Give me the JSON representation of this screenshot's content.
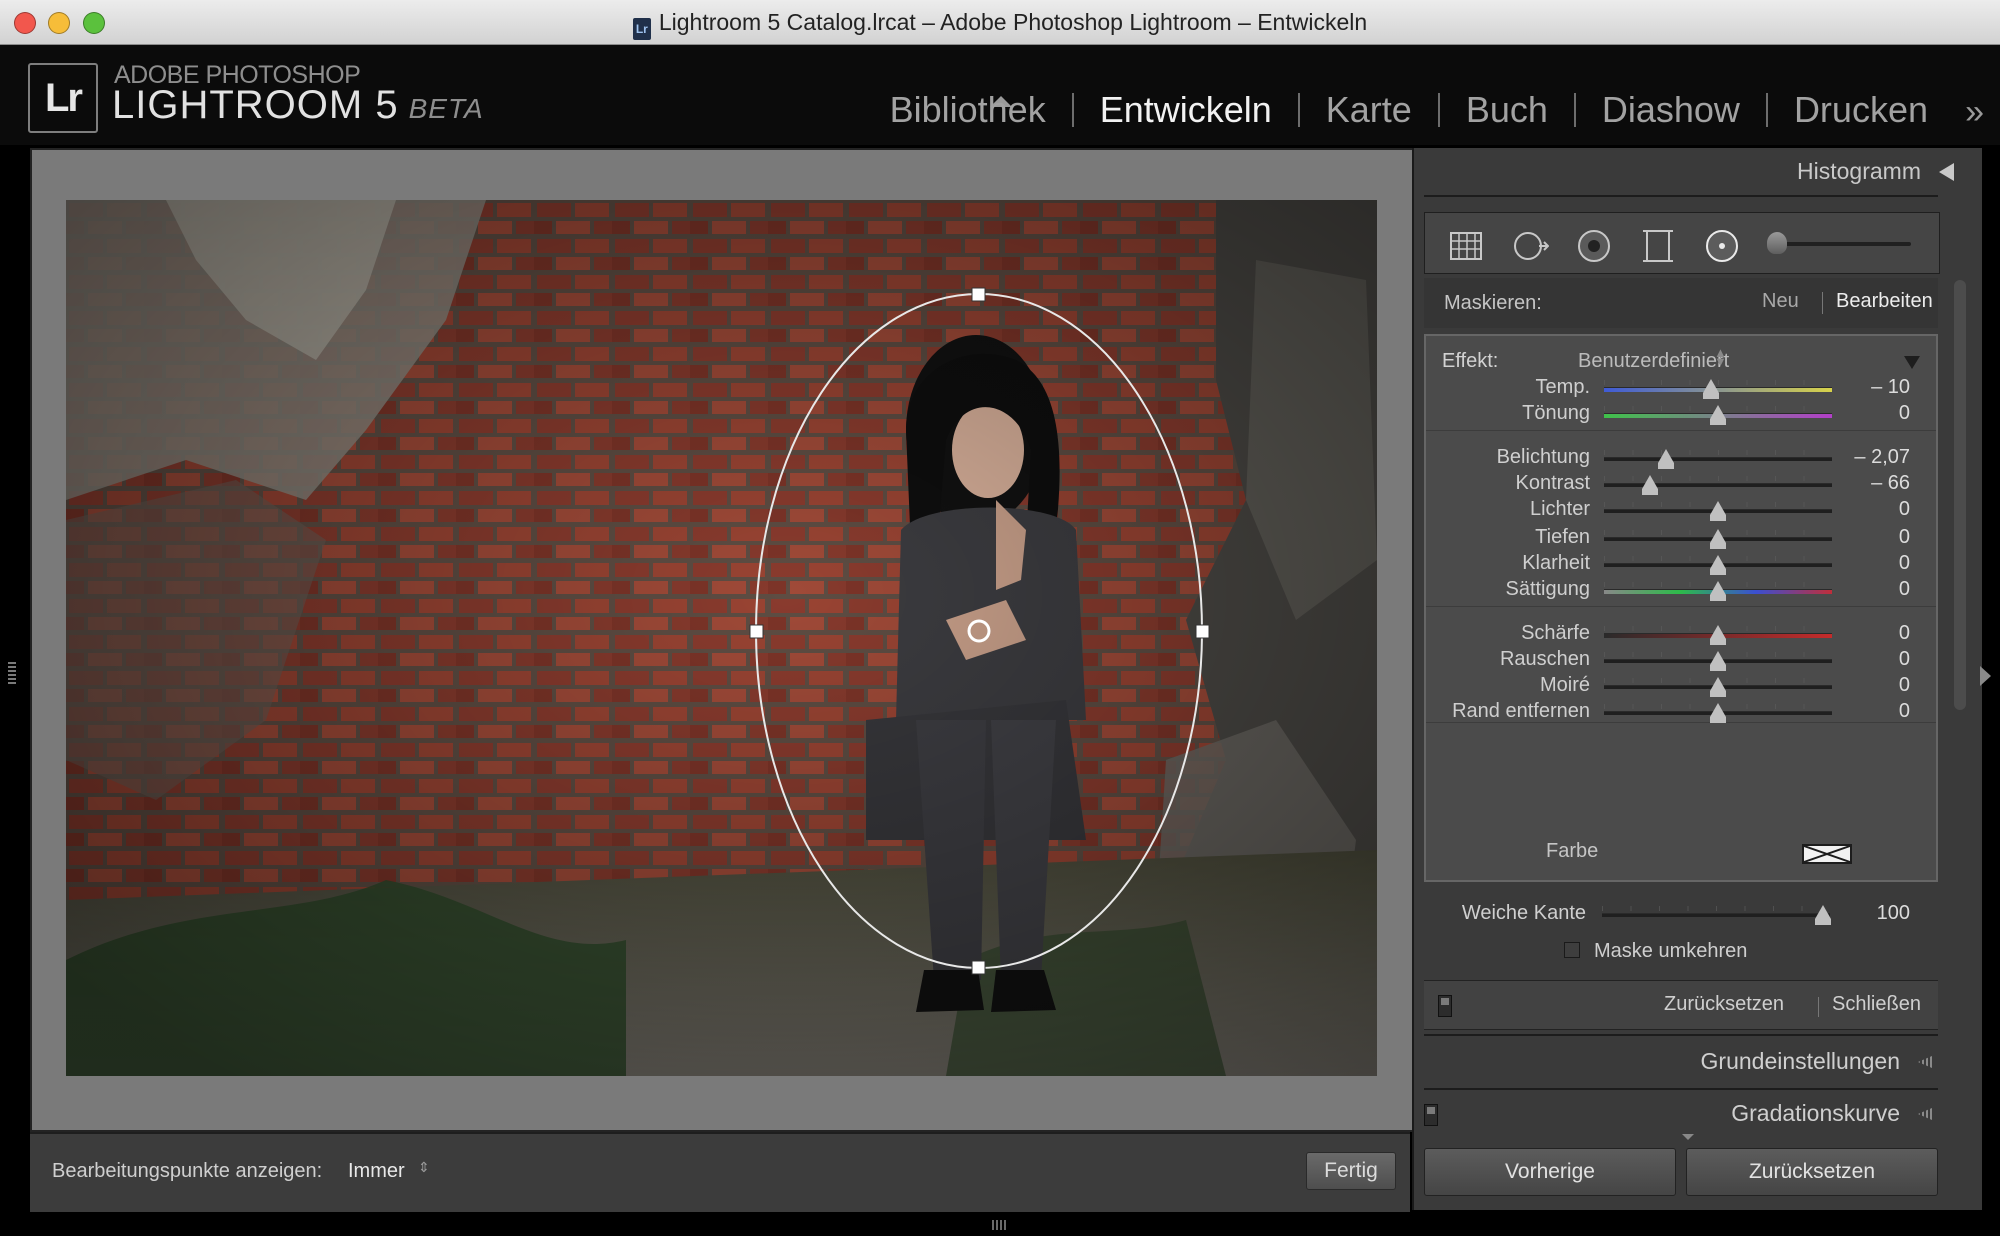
{
  "window": {
    "title": "Lightroom 5 Catalog.lrcat – Adobe Photoshop Lightroom – Entwickeln",
    "doc_icon": "Lr"
  },
  "branding": {
    "logo": "Lr",
    "top": "ADOBE PHOTOSHOP",
    "main": "LIGHTROOM 5",
    "beta": "BETA"
  },
  "modules": [
    {
      "label": "Bibliothek",
      "active": false
    },
    {
      "label": "Entwickeln",
      "active": true
    },
    {
      "label": "Karte",
      "active": false
    },
    {
      "label": "Buch",
      "active": false
    },
    {
      "label": "Diashow",
      "active": false
    },
    {
      "label": "Drucken",
      "active": false
    }
  ],
  "more_modules": "»",
  "toolbar": {
    "show_points_label": "Bearbeitungspunkte anzeigen:",
    "show_points_value": "Immer",
    "done_label": "Fertig"
  },
  "panel": {
    "histogram_label": "Histogramm",
    "mask": {
      "label": "Maskieren:",
      "new": "Neu",
      "edit": "Bearbeiten"
    },
    "effect": {
      "label": "Effekt:",
      "value": "Benutzerdefiniert"
    },
    "sliders": [
      {
        "label": "Temp.",
        "value": "– 10",
        "pos": 0.47,
        "track": "temp"
      },
      {
        "label": "Tönung",
        "value": "0",
        "pos": 0.5,
        "track": "tint"
      },
      {
        "label": "Belichtung",
        "value": "– 2,07",
        "pos": 0.27,
        "track": "plain"
      },
      {
        "label": "Kontrast",
        "value": "– 66",
        "pos": 0.2,
        "track": "plain"
      },
      {
        "label": "Lichter",
        "value": "0",
        "pos": 0.5,
        "track": "plain"
      },
      {
        "label": "Tiefen",
        "value": "0",
        "pos": 0.5,
        "track": "plain"
      },
      {
        "label": "Klarheit",
        "value": "0",
        "pos": 0.5,
        "track": "plain"
      },
      {
        "label": "Sättigung",
        "value": "0",
        "pos": 0.5,
        "track": "sat"
      },
      {
        "label": "Schärfe",
        "value": "0",
        "pos": 0.5,
        "track": "sharp"
      },
      {
        "label": "Rauschen",
        "value": "0",
        "pos": 0.5,
        "track": "plain"
      },
      {
        "label": "Moiré",
        "value": "0",
        "pos": 0.5,
        "track": "plain"
      },
      {
        "label": "Rand entfernen",
        "value": "0",
        "pos": 0.5,
        "track": "plain"
      }
    ],
    "color_label": "Farbe",
    "feather": {
      "label": "Weiche Kante",
      "value": "100",
      "pos": 0.97
    },
    "invert_label": "Maske umkehren",
    "reset_label": "Zurücksetzen",
    "close_label": "Schließen",
    "sections": [
      "Grundeinstellungen",
      "Gradationskurve"
    ],
    "previous_label": "Vorherige",
    "reset_all_label": "Zurücksetzen"
  },
  "colors": {
    "temp_gradient": [
      "#3f5bd6",
      "#d7d24a"
    ],
    "tint_gradient": [
      "#3fc24a",
      "#b33fc9"
    ],
    "sat_gradient": [
      "#2dbb4a",
      "#c02e3a"
    ],
    "sharp_gradient": [
      "#2a2a2a",
      "#c62b2b"
    ]
  }
}
